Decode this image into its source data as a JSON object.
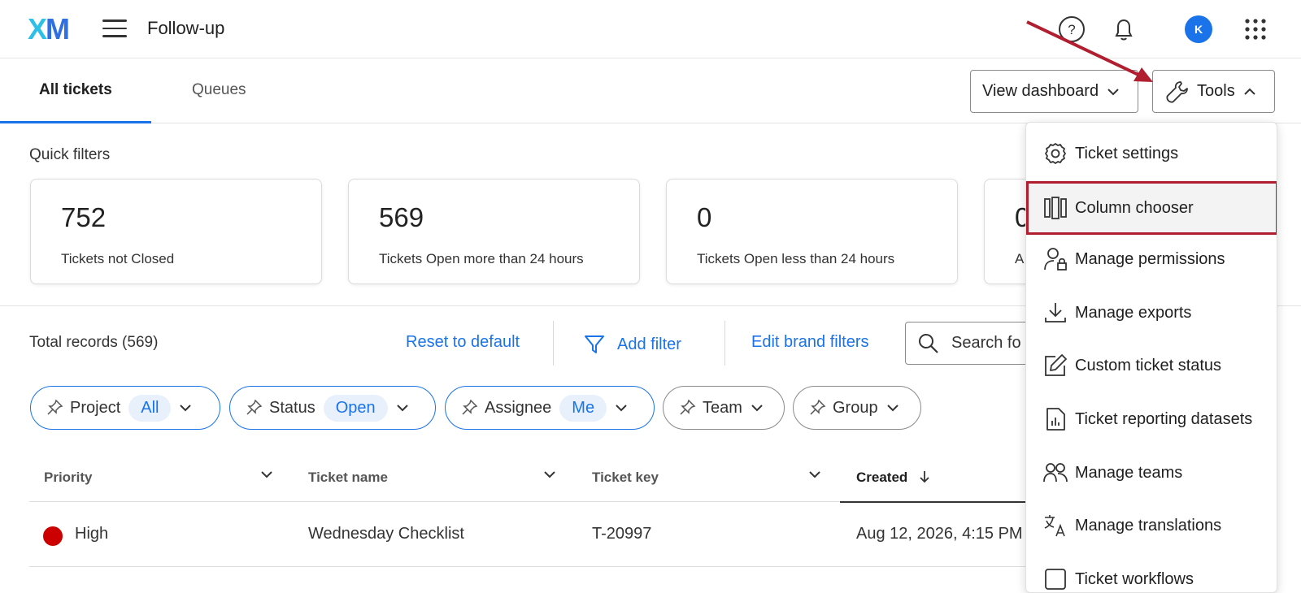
{
  "header": {
    "logo_x": "X",
    "logo_m": "M",
    "app_title": "Follow-up",
    "avatar_initial": "K"
  },
  "tabs": [
    {
      "label": "All tickets"
    },
    {
      "label": "Queues"
    }
  ],
  "toolbar": {
    "view_dashboard": "View dashboard",
    "tools": "Tools"
  },
  "quick_filters": {
    "label": "Quick filters",
    "cards": [
      {
        "value": "752",
        "label": "Tickets not Closed"
      },
      {
        "value": "569",
        "label": "Tickets Open more than 24 hours"
      },
      {
        "value": "0",
        "label": "Tickets Open less than 24 hours"
      },
      {
        "value": "0",
        "label": "A"
      }
    ]
  },
  "records": {
    "total": "Total records (569)",
    "reset": "Reset to default",
    "add_filter": "Add filter",
    "edit_brand": "Edit brand filters",
    "search_placeholder": "Search fo"
  },
  "chips": [
    {
      "label": "Project",
      "value": "All"
    },
    {
      "label": "Status",
      "value": "Open"
    },
    {
      "label": "Assignee",
      "value": "Me"
    },
    {
      "label": "Team"
    },
    {
      "label": "Group"
    }
  ],
  "table": {
    "headers": [
      "Priority",
      "Ticket name",
      "Ticket key",
      "Created"
    ],
    "rows": [
      {
        "priority": "High",
        "name": "Wednesday Checklist",
        "key": "T-20997",
        "created": "Aug 12, 2026, 4:15 PM"
      }
    ]
  },
  "tools_menu": {
    "items": [
      {
        "label": "Ticket settings",
        "icon": "gear-icon"
      },
      {
        "label": "Column chooser",
        "icon": "columns-icon"
      },
      {
        "label": "Manage permissions",
        "icon": "user-lock-icon"
      },
      {
        "label": "Manage exports",
        "icon": "download-icon"
      },
      {
        "label": "Custom ticket status",
        "icon": "edit-icon"
      },
      {
        "label": "Ticket reporting datasets",
        "icon": "report-icon"
      },
      {
        "label": "Manage teams",
        "icon": "people-icon"
      },
      {
        "label": "Manage translations",
        "icon": "translate-icon"
      },
      {
        "label": "Ticket workflows",
        "icon": "workflow-icon"
      }
    ]
  },
  "colors": {
    "accent": "#1a73e8",
    "highlight": "#b01e2f",
    "priority_high": "#cc0000"
  }
}
